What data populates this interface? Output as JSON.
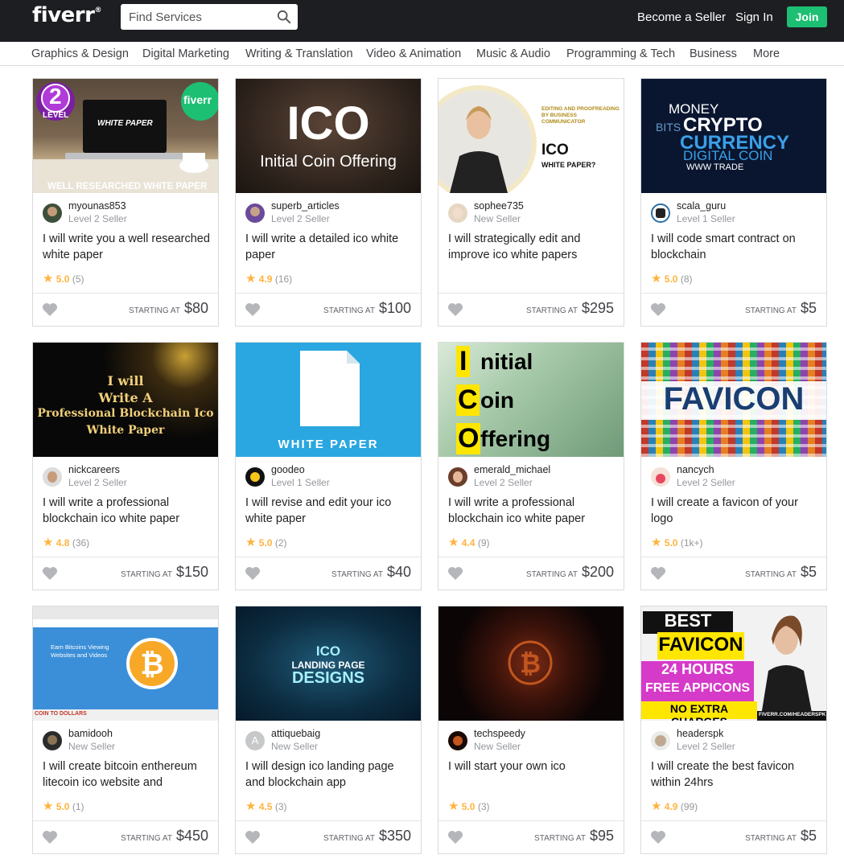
{
  "header": {
    "logo": "fiverr",
    "logo_mark": "®",
    "search_placeholder": "Find Services",
    "become_seller": "Become a Seller",
    "sign_in": "Sign In",
    "join": "Join"
  },
  "categories": [
    "Graphics & Design",
    "Digital Marketing",
    "Writing & Translation",
    "Video & Animation",
    "Music & Audio",
    "Programming & Tech",
    "Business",
    "More"
  ],
  "starting_label": "STARTING AT",
  "gigs": [
    {
      "seller": "myounas853",
      "level": "Level 2 Seller",
      "title": "I will write you a well researched white paper",
      "rating": "5.0",
      "count": "(5)",
      "price": "$80",
      "thumb": {
        "badge_top": "LEVEL",
        "badge_num": "2",
        "screen": "WHITE PAPER",
        "caption": "WELL RESEARCHED WHITE PAPER",
        "brand": "fiverr"
      }
    },
    {
      "seller": "superb_articles",
      "level": "Level 2 Seller",
      "title": "I will write a detailed ico white paper",
      "rating": "4.9",
      "count": "(16)",
      "price": "$100",
      "thumb": {
        "big": "ICO",
        "small": "Initial Coin Offering"
      }
    },
    {
      "seller": "sophee735",
      "level": "New Seller",
      "title": "I will strategically edit and improve ico white papers",
      "rating": "",
      "count": "",
      "price": "$295",
      "thumb": {
        "small": "EDITING AND PROOFREADING BY BUSINESS COMMUNICATOR",
        "big": "ICO",
        "sub": "WHITE PAPER?"
      }
    },
    {
      "seller": "scala_guru",
      "level": "Level 1 Seller",
      "title": "I will code smart contract on blockchain",
      "rating": "5.0",
      "count": "(8)",
      "price": "$5",
      "thumb": {
        "w1": "MONEY",
        "w2": "CRYPTO",
        "w3": "CURRENCY",
        "w4": "DIGITAL COIN",
        "w5": "WWW TRADE",
        "w6": "BITS"
      }
    },
    {
      "seller": "nickcareers",
      "level": "Level 2 Seller",
      "title": "I will write a professional blockchain ico white paper",
      "rating": "4.8",
      "count": "(36)",
      "price": "$150",
      "thumb": {
        "l1": "I will",
        "l2": "Write A",
        "l3": "Professional Blockchain Ico",
        "l4": "White Paper"
      }
    },
    {
      "seller": "goodeo",
      "level": "Level 1 Seller",
      "title": "I will revise and edit your ico white paper",
      "rating": "5.0",
      "count": "(2)",
      "price": "$40",
      "thumb": {
        "caption": "WHITE PAPER"
      }
    },
    {
      "seller": "emerald_michael",
      "level": "Level 2 Seller",
      "title": "I will write a professional blockchain ico white paper",
      "rating": "4.4",
      "count": "(9)",
      "price": "$200",
      "thumb": {
        "l1": "nitial",
        "l2": "oin",
        "l3": "ffering",
        "c1": "I",
        "c2": "C",
        "c3": "O"
      }
    },
    {
      "seller": "nancych",
      "level": "Level 2 Seller",
      "title": "I will create a favicon of your logo",
      "rating": "5.0",
      "count": "(1k+)",
      "price": "$5",
      "thumb": {
        "big": "FAVICON"
      }
    },
    {
      "seller": "bamidooh",
      "level": "New Seller",
      "title": "I will create bitcoin enthereum litecoin ico website and",
      "rating": "5.0",
      "count": "(1)",
      "price": "$450",
      "thumb": {
        "text": "Earn Bitcoins Viewing Websites and Videos",
        "caption": "COIN TO DOLLARS"
      }
    },
    {
      "seller": "attiquebaig",
      "level": "New Seller",
      "title": "I will design ico landing page and blockchain app",
      "rating": "4.5",
      "count": "(3)",
      "price": "$350",
      "thumb": {
        "l1": "ICO",
        "l2": "LANDING PAGE",
        "l3": "DESIGNS"
      },
      "avatar_letter": "A"
    },
    {
      "seller": "techspeedy",
      "level": "New Seller",
      "title": "I will start your own ico",
      "rating": "5.0",
      "count": "(3)",
      "price": "$95",
      "thumb": {}
    },
    {
      "seller": "headerspk",
      "level": "Level 2 Seller",
      "title": "I will create the best favicon within 24hrs",
      "rating": "4.9",
      "count": "(99)",
      "price": "$5",
      "thumb": {
        "l1": "BEST",
        "l2": "FAVICON",
        "l3": "24 HOURS",
        "l4": "FREE APPICONS",
        "l5": "NO EXTRA CHARGES",
        "l6": "FIVERR.COM/HEADERSPK"
      }
    }
  ],
  "colors": {
    "header_bg": "#1d1e22",
    "join_green": "#1dbf73",
    "star": "#ffb33e"
  }
}
